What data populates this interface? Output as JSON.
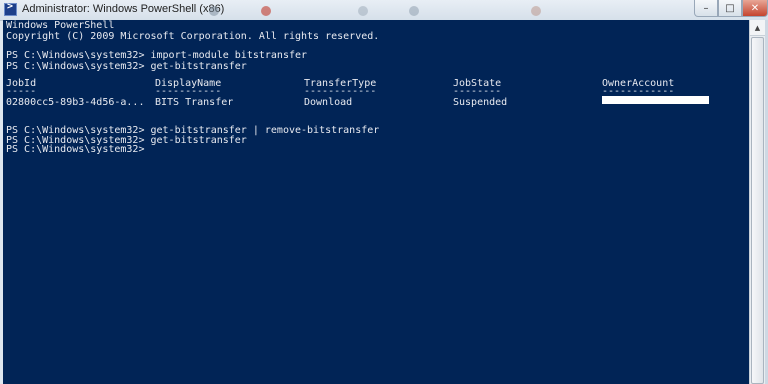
{
  "window": {
    "title": "Administrator: Windows PowerShell (x86)",
    "controls": {
      "minimize": "–",
      "maximize": "□",
      "close": "✕"
    }
  },
  "console": {
    "banner": [
      "Windows PowerShell",
      "Copyright (C) 2009 Microsoft Corporation. All rights reserved."
    ],
    "commands_1": [
      "PS C:\\Windows\\system32> import-module bitstransfer",
      "PS C:\\Windows\\system32> get-bitstransfer"
    ],
    "table": {
      "headers": [
        "JobId",
        "DisplayName",
        "TransferType",
        "JobState",
        "OwnerAccount"
      ],
      "underlines": [
        "-----",
        "-----------",
        "------------",
        "--------",
        "------------"
      ],
      "rows": [
        [
          "02800cc5-89b3-4d56-a...",
          "BITS Transfer",
          "Download",
          "Suspended",
          ""
        ]
      ]
    },
    "commands_2": [
      "PS C:\\Windows\\system32> get-bitstransfer | remove-bitstransfer",
      "PS C:\\Windows\\system32> get-bitstransfer",
      "PS C:\\Windows\\system32>"
    ]
  },
  "scrollbar": {
    "up_arrow": "▲"
  },
  "colors": {
    "console_bg": "#012456",
    "console_fg": "#e8eaf0"
  }
}
